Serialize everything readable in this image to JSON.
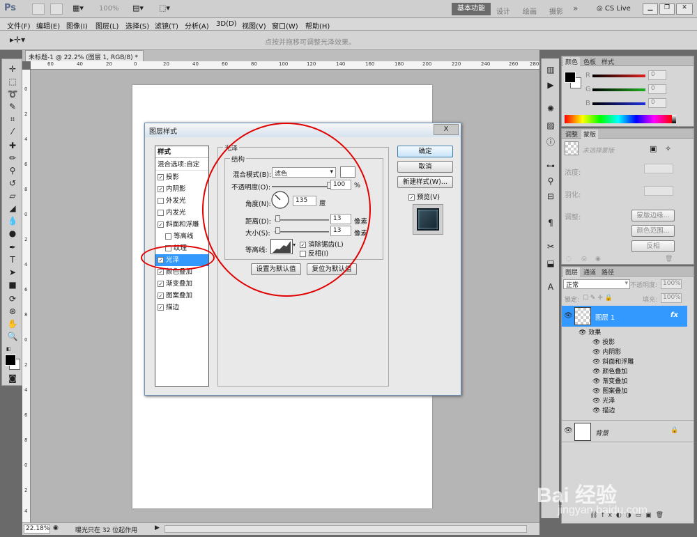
{
  "appbar": {
    "logo": "Ps",
    "zoom": "100%",
    "workspaces": [
      "基本功能",
      "设计",
      "绘画",
      "摄影"
    ],
    "more": "»",
    "cslive": "CS Live"
  },
  "menus": [
    "文件(F)",
    "编辑(E)",
    "图像(I)",
    "图层(L)",
    "选择(S)",
    "滤镜(T)",
    "分析(A)",
    "3D(D)",
    "视图(V)",
    "窗口(W)",
    "帮助(H)"
  ],
  "options": {
    "hint": "点按并拖移可调整光泽效果。"
  },
  "document": {
    "tab_title": "未标题-1 @ 22.2% (图层 1, RGB/8) *",
    "ruler_h": [
      "60",
      "40",
      "20",
      "0",
      "20",
      "40",
      "60",
      "80",
      "100",
      "120",
      "140",
      "160",
      "180",
      "200",
      "220",
      "240",
      "260",
      "280"
    ],
    "ruler_v": [
      "0",
      "2",
      "4",
      "6",
      "8",
      "0",
      "2",
      "4",
      "6",
      "8",
      "0",
      "2",
      "4",
      "6",
      "8",
      "0",
      "2",
      "4"
    ]
  },
  "status": {
    "zoom": "22.18%",
    "info": "曝光只在 32 位起作用"
  },
  "dialog": {
    "title": "图层样式",
    "close": "X",
    "styles_header": "样式",
    "blend_options": "混合选项:自定",
    "styles": [
      {
        "label": "投影",
        "checked": "✓"
      },
      {
        "label": "内阴影",
        "checked": "✓"
      },
      {
        "label": "外发光",
        "checked": ""
      },
      {
        "label": "内发光",
        "checked": ""
      },
      {
        "label": "斜面和浮雕",
        "checked": "✓"
      },
      {
        "label": "等高线",
        "checked": ""
      },
      {
        "label": "纹理",
        "checked": ""
      },
      {
        "label": "光泽",
        "checked": "✓"
      },
      {
        "label": "颜色叠加",
        "checked": "✓"
      },
      {
        "label": "渐变叠加",
        "checked": "✓"
      },
      {
        "label": "图案叠加",
        "checked": "✓"
      },
      {
        "label": "描边",
        "checked": "✓"
      }
    ],
    "section_title": "光泽",
    "group_title": "结构",
    "blend_mode_label": "混合模式(B):",
    "blend_mode_value": "滤色",
    "opacity_label": "不透明度(O):",
    "opacity_value": "100",
    "opacity_unit": "%",
    "opacity_fraction": 1.0,
    "angle_label": "角度(N):",
    "angle_value": "135",
    "angle_unit": "度",
    "distance_label": "距离(D):",
    "distance_value": "13",
    "distance_unit": "像素",
    "distance_fraction": 0.05,
    "size_label": "大小(S):",
    "size_value": "13",
    "size_unit": "像素",
    "size_fraction": 0.05,
    "contour_label": "等高线:",
    "antialias_label": "消除锯齿(L)",
    "antialias_checked": "✓",
    "invert_label": "反相(I)",
    "invert_checked": "",
    "make_default": "设置为默认值",
    "reset_default": "复位为默认值",
    "ok": "确定",
    "cancel": "取消",
    "new_style": "新建样式(W)...",
    "preview_label": "预览(V)",
    "preview_checked": "✓"
  },
  "color_panel": {
    "tabs": [
      "颜色",
      "色板",
      "样式"
    ],
    "channels": [
      {
        "name": "R",
        "value": "0",
        "color": "#e02020"
      },
      {
        "name": "G",
        "value": "0",
        "color": "#20b020"
      },
      {
        "name": "B",
        "value": "0",
        "color": "#2030e0"
      }
    ]
  },
  "adjust_panel": {
    "tabs": [
      "调整",
      "蒙版"
    ],
    "mask_label": "未选择蒙版",
    "density_label": "浓度:",
    "feather_label": "羽化:",
    "refine_label": "调整:",
    "mask_edge": "蒙版边缘...",
    "color_range": "颜色范围...",
    "invert": "反相"
  },
  "layers_panel": {
    "tabs": [
      "图层",
      "通道",
      "路径"
    ],
    "blend_mode": "正常",
    "opacity_label": "不透明度:",
    "opacity_value": "100%",
    "lock_label": "锁定:",
    "fill_label": "填充:",
    "fill_value": "100%",
    "layer1": "图层 1",
    "fx": "fx",
    "effects_label": "效果",
    "effects": [
      "投影",
      "内阴影",
      "斜面和浮雕",
      "颜色叠加",
      "渐变叠加",
      "图案叠加",
      "光泽",
      "描边"
    ],
    "background": "背景"
  },
  "watermark": {
    "line1": "Bai 经验",
    "line2": "jingyan.baidu.com"
  },
  "colors": {
    "accent": "#3399ff",
    "annotation": "#e10000"
  }
}
